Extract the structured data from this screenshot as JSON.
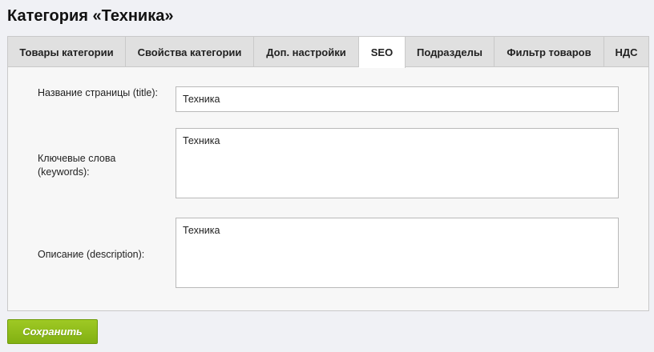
{
  "page": {
    "title": "Категория «Техника»"
  },
  "tabs": [
    {
      "label": "Товары категории"
    },
    {
      "label": "Свойства категории"
    },
    {
      "label": "Доп. настройки"
    },
    {
      "label": "SEO",
      "active": true
    },
    {
      "label": "Подразделы"
    },
    {
      "label": "Фильтр товаров"
    },
    {
      "label": "НДС"
    }
  ],
  "form": {
    "title_label": "Название страницы (title):",
    "title_value": "Техника",
    "keywords_label": "Ключевые слова (keywords):",
    "keywords_value": "Техника",
    "description_label": "Описание (description):",
    "description_value": "Техника"
  },
  "actions": {
    "save_label": "Сохранить"
  },
  "colors": {
    "background": "#f0f1f5",
    "tab_bar": "#e0e0e0",
    "active_tab": "#ffffff",
    "save_button": "#8cbb17"
  }
}
